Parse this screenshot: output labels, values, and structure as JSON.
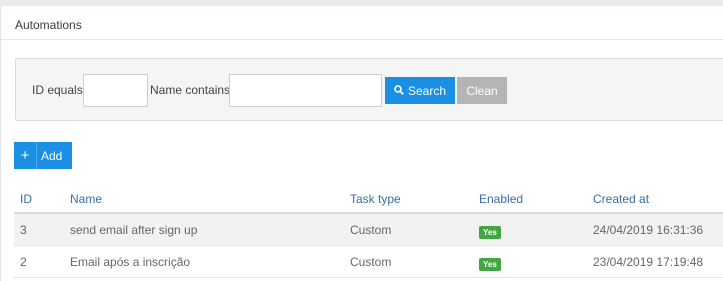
{
  "panel": {
    "title": "Automations"
  },
  "filters": {
    "id_label": "ID equals",
    "id_value": "",
    "name_label": "Name contains",
    "name_value": "",
    "search_label": "Search",
    "search_icon": "search-icon",
    "clean_label": "Clean"
  },
  "add_button": {
    "label": "Add",
    "icon": "plus-icon"
  },
  "table": {
    "columns": [
      "ID",
      "Name",
      "Task type",
      "Enabled",
      "Created at"
    ],
    "rows": [
      {
        "id": "3",
        "name": "send email after sign up",
        "task_type": "Custom",
        "enabled": "Yes",
        "created_at": "24/04/2019 16:31:36"
      },
      {
        "id": "2",
        "name": "Email após a inscrição",
        "task_type": "Custom",
        "enabled": "Yes",
        "created_at": "23/04/2019 17:19:48"
      }
    ]
  },
  "colors": {
    "primary": "#1a8fe3",
    "clean_button": "#b5b5b5",
    "enabled_badge": "#3fa83f",
    "header_text": "#3a6ea5"
  }
}
